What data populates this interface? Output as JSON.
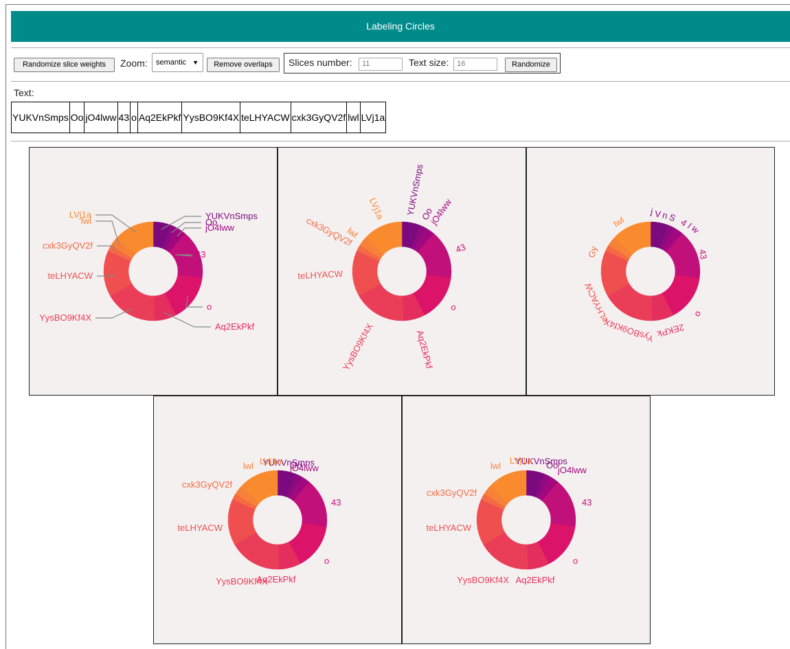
{
  "header": {
    "title": "Labeling Circles"
  },
  "controls": {
    "randomize_weights_label": "Randomize slice weights",
    "zoom_label": "Zoom:",
    "zoom_value": "semantic",
    "remove_overlaps_label": "Remove overlaps",
    "slices_label": "Slices number:",
    "slices_value": "11",
    "text_size_label": "Text size:",
    "text_size_value": "16",
    "randomize_label": "Randomize"
  },
  "text_section": {
    "label": "Text:"
  },
  "slices": [
    {
      "label": "YUKVnSmps",
      "weight": 3.0,
      "color": "#7a0a7e"
    },
    {
      "label": "Oo",
      "weight": 1.0,
      "color": "#8d0a80"
    },
    {
      "label": "jO4lww",
      "weight": 1.5,
      "color": "#a1087f"
    },
    {
      "label": "43",
      "weight": 8.0,
      "color": "#c2107a"
    },
    {
      "label": "o",
      "weight": 7.5,
      "color": "#db1369"
    },
    {
      "label": "Aq2EkPkf",
      "weight": 3.5,
      "color": "#e42e5e"
    },
    {
      "label": "YysBO9Kf4X",
      "weight": 8.5,
      "color": "#ea3d58"
    },
    {
      "label": "teLHYACW",
      "weight": 7.5,
      "color": "#f04f4f"
    },
    {
      "label": "cxk3GyQV2f",
      "weight": 1.0,
      "color": "#f46a43"
    },
    {
      "label": "lwl",
      "weight": 1.5,
      "color": "#f88139"
    },
    {
      "label": "LVj1a",
      "weight": 6.5,
      "color": "#fa8a2e"
    }
  ],
  "panels": {
    "p1": {
      "labels": [
        "YUKVnSmps",
        "Oo",
        "jO4lww",
        "43",
        "o",
        "Aq2EkPkf",
        "YysBO9Kf4X",
        "teLHYACW",
        "cxk3GyQV2f",
        "lwl",
        "LVj1a"
      ]
    },
    "p2": {
      "labels": [
        "YUKVnSmps",
        "Oo",
        "jO4lww",
        "43",
        "o",
        "Aq2EkPkf",
        "YysBO9Kf4X",
        "teLHYACW",
        "cxk3GyQV2f",
        "lwl",
        "LVj1a"
      ]
    },
    "p3": {
      "labels": [
        "j",
        "V",
        "n",
        "S",
        "4",
        "l",
        "w",
        "43",
        "o",
        "2EKPk",
        "YysBO9Kf4X",
        "eLHYACW",
        "Gy",
        "lwl"
      ]
    },
    "p4": {
      "labels": [
        "YUKVnSmps",
        "Oo",
        "jO4lww",
        "43",
        "o",
        "Aq2EkPkf",
        "YysBO9Kf4X",
        "teLHYACW",
        "cxk3GyQV2f",
        "lwl",
        "LVj1a"
      ]
    },
    "p5": {
      "labels": [
        "YUKVnSmps",
        "Oo",
        "jO4lww",
        "43",
        "o",
        "Aq2EkPkf",
        "YysBO9Kf4X",
        "teLHYACW",
        "cxk3GyQV2f",
        "lwl",
        "LVj1a"
      ]
    }
  }
}
